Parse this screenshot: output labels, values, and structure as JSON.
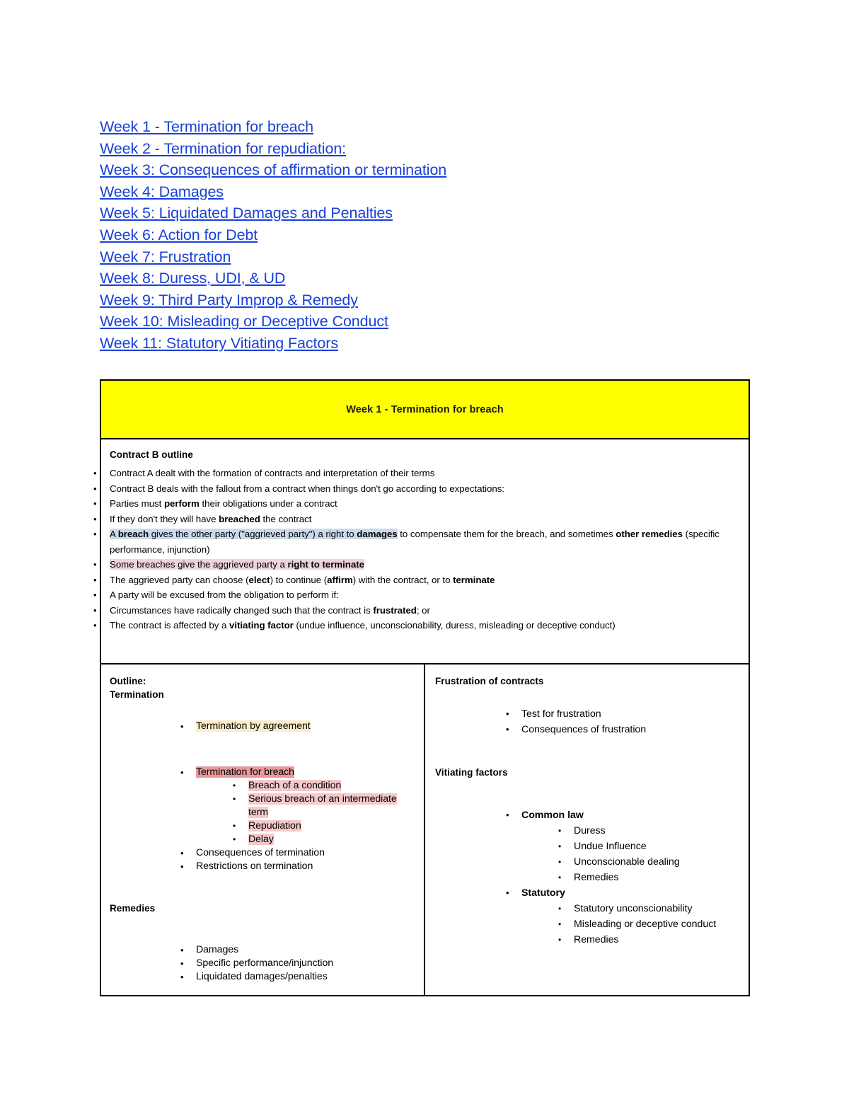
{
  "toc": {
    "links": [
      "Week 1 - Termination for breach",
      "Week 2 - Termination for repudiation:",
      "Week 3: Consequences of affirmation or termination",
      "Week 4: Damages",
      "Week 5: Liquidated Damages and Penalties",
      "Week 6: Action for Debt",
      "Week 7: Frustration",
      "Week 8: Duress, UDI, & UD",
      "Week 9:  Third Party Improp & Remedy",
      "Week 10: Misleading or Deceptive Conduct",
      "Week 11: Statutory Vitiating Factors"
    ],
    "link_color": "#1a41d8"
  },
  "banner": {
    "title": "Week 1 - Termination for breach",
    "background": "#ffff00"
  },
  "outline_cell": {
    "heading": "Contract B outline",
    "bullets": {
      "b1": "Contract A dealt with the formation of contracts and interpretation of their terms",
      "b2": "Contract B deals with the fallout from a contract when things don't go according to expectations:",
      "b2_1_a": "Parties must ",
      "b2_1_bold": "perform",
      "b2_1_b": " their obligations under a contract",
      "b2_2_a": "If they don't they will have ",
      "b2_2_bold": "breached",
      "b2_2_b": " the contract",
      "b2_3_a": "A ",
      "b2_3_bold1": "breach",
      "b2_3_b": " gives the other party (\"aggrieved party\") a right to ",
      "b2_3_bold2": "damages",
      "b2_3_c": " to compensate them for the breach, and sometimes ",
      "b2_3_bold3": "other remedies",
      "b2_3_d": " (specific performance, injunction)",
      "b2_4_a": "Some breaches give the aggrieved party a ",
      "b2_4_bold": "right to terminate",
      "b2_4_1_a": "The aggrieved party can choose (",
      "b2_4_1_bold1": "elect",
      "b2_4_1_b": ") to continue (",
      "b2_4_1_bold2": "affirm",
      "b2_4_1_c": ") with the contract, or to ",
      "b2_4_1_bold3": "terminate",
      "b3": "A party will be excused from the obligation to perform if:",
      "b3_1_a": "Circumstances have radically changed such that the contract is ",
      "b3_1_bold": "frustrated",
      "b3_1_b": "; or",
      "b3_2_a": "The contract is affected by a ",
      "b3_2_bold": "vitiating factor",
      "b3_2_b": " (undue influence, unconscionability, duress, misleading or deceptive conduct)"
    },
    "highlights": {
      "blue": "#ccd9ea",
      "pink": "#edd5dd"
    }
  },
  "left_column": {
    "heading_line1": "Outline:",
    "heading_line2": "Termination",
    "termination_by_agreement": "Termination by agreement",
    "termination_for_breach": "Termination for breach",
    "breach_subitems": [
      "Breach of a condition",
      "Serious breach of an intermediate term",
      "Repudiation",
      "Delay"
    ],
    "consequences": "Consequences of termination",
    "restrictions": "Restrictions on termination",
    "remedies_heading": "Remedies",
    "remedies_items": [
      "Damages",
      "Specific performance/injunction",
      "Liquidated damages/penalties"
    ],
    "highlights": {
      "cream": "#fbeccc",
      "salmon": "#e8999c",
      "rose": "#f4c9ca"
    }
  },
  "right_column": {
    "frustration_heading": "Frustration of contracts",
    "frustration_items": [
      "Test for frustration",
      "Consequences of frustration"
    ],
    "vitiating_heading": "Vitiating factors",
    "common_law_label": "Common law",
    "common_law_items": [
      "Duress",
      "Undue Influence",
      "Unconscionable dealing",
      "Remedies"
    ],
    "statutory_label": "Statutory",
    "statutory_items": [
      "Statutory unconscionability",
      "Misleading or deceptive conduct",
      "Remedies"
    ]
  }
}
